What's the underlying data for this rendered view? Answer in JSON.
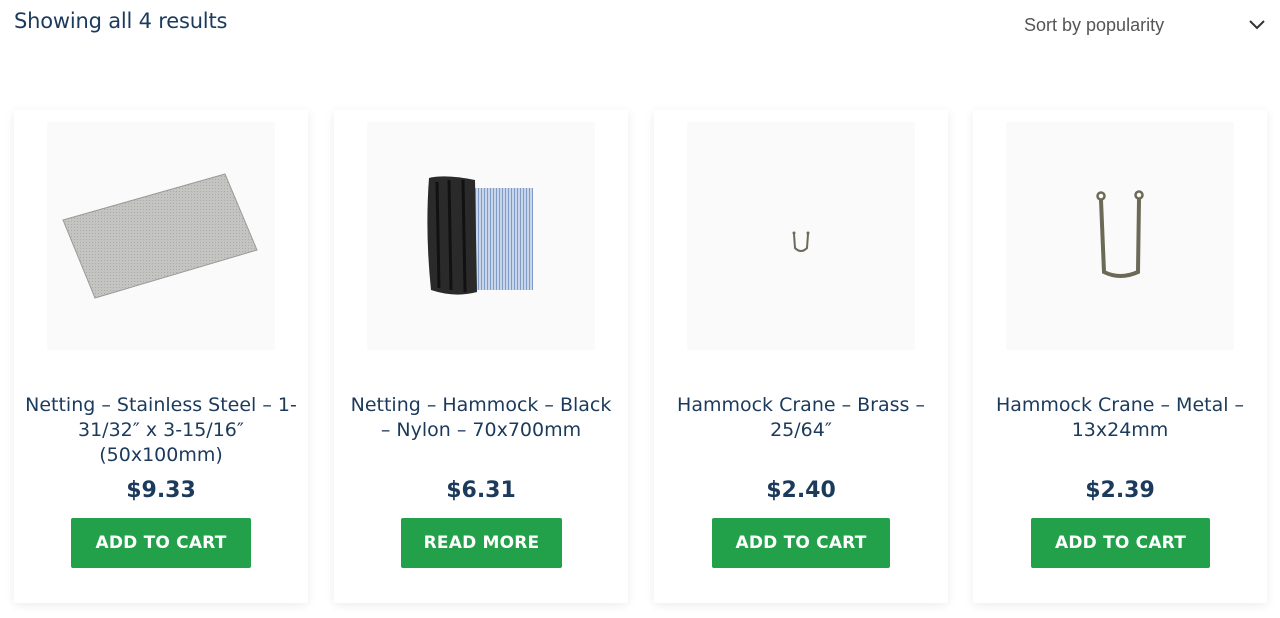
{
  "toolbar": {
    "result_count": "Showing all 4 results",
    "sort_selected": "Sort by popularity"
  },
  "products": [
    {
      "title": "Netting – Stainless Steel – 1-31/32″ x 3-15/16″ (50x100mm)",
      "price": "$9.33",
      "button": "ADD TO CART",
      "image_icon": "stainless-steel-mesh-image"
    },
    {
      "title": "Netting – Hammock – Black – Nylon – 70x700mm",
      "price": "$6.31",
      "button": "READ MORE",
      "image_icon": "nylon-netting-image"
    },
    {
      "title": "Hammock Crane – Brass – 25/64″",
      "price": "$2.40",
      "button": "ADD TO CART",
      "image_icon": "brass-crane-image"
    },
    {
      "title": "Hammock Crane – Metal – 13x24mm",
      "price": "$2.39",
      "button": "ADD TO CART",
      "image_icon": "metal-crane-image"
    }
  ],
  "colors": {
    "accent_green": "#22a04a",
    "heading_navy": "#1b3a5c"
  }
}
